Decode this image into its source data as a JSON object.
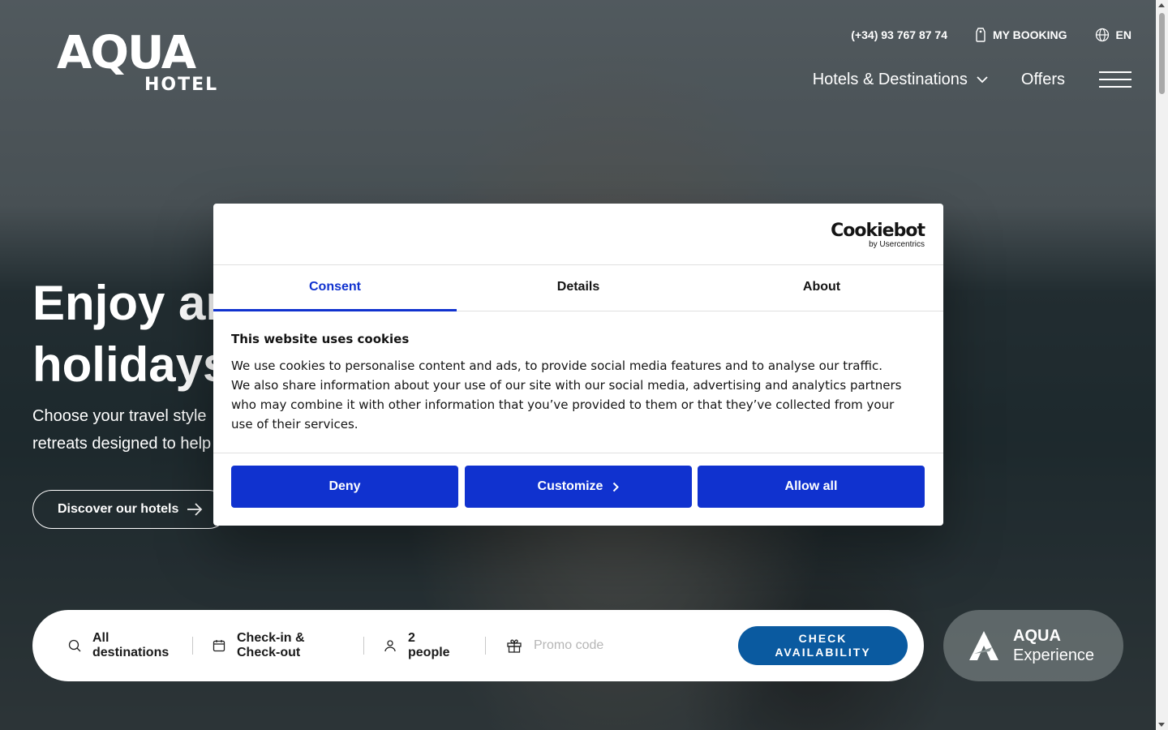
{
  "header": {
    "logo_brand": "AQUA",
    "logo_sub": "HOTEL",
    "phone": "(+34) 93 767 87 74",
    "my_booking": "MY BOOKING",
    "language": "EN",
    "nav_hotels": "Hotels & Destinations",
    "nav_offers": "Offers"
  },
  "hero": {
    "title_line1": "Enjoy an",
    "title_line2": "holidays",
    "subtitle_line1": "Choose your travel style",
    "subtitle_line2": "retreats designed to help",
    "cta": "Discover our hotels"
  },
  "booking": {
    "destination_line1": "All",
    "destination_line2": "destinations",
    "dates_line1": "Check-in &",
    "dates_line2": "Check-out",
    "people_line1": "2",
    "people_line2": "people",
    "promo_placeholder": "Promo code",
    "check_line1": "CHECK",
    "check_line2": "AVAILABILITY"
  },
  "aqua_experience": {
    "line1": "AQUA",
    "line2": "Experience"
  },
  "cookie_dialog": {
    "logo_word": "Cookiebot",
    "logo_by": "by Usercentrics",
    "tabs": [
      "Consent",
      "Details",
      "About"
    ],
    "active_tab": "Consent",
    "heading": "This website uses cookies",
    "body": "We use cookies to personalise content and ads, to provide social media features and to analyse our traffic. We also share information about your use of our site with our social media, advertising and analytics partners who may combine it with other information that you’ve provided to them or that they’ve collected from your use of their services.",
    "deny": "Deny",
    "customize": "Customize",
    "allow_all": "Allow all",
    "button_color": "#1032cf"
  }
}
